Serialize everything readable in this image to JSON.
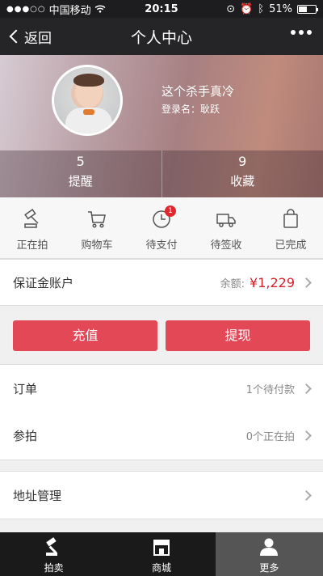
{
  "status": {
    "carrier": "中国移动",
    "time": "20:15",
    "battery": "51%"
  },
  "nav": {
    "back": "返回",
    "title": "个人中心"
  },
  "profile": {
    "name": "这个杀手真冷",
    "login_label": "登录名：耿跃"
  },
  "stats": [
    {
      "num": "5",
      "label": "提醒"
    },
    {
      "num": "9",
      "label": "收藏"
    }
  ],
  "icons": [
    {
      "label": "正在拍",
      "icon": "auction-hammer-icon"
    },
    {
      "label": "购物车",
      "icon": "cart-icon"
    },
    {
      "label": "待支付",
      "icon": "clock-icon",
      "badge": "1"
    },
    {
      "label": "待签收",
      "icon": "truck-icon"
    },
    {
      "label": "已完成",
      "icon": "bag-icon"
    }
  ],
  "deposit": {
    "label": "保证金账户",
    "balance_label": "余额:",
    "amount": "¥1,229"
  },
  "buttons": {
    "recharge": "充值",
    "withdraw": "提现"
  },
  "orders": {
    "label": "订单",
    "sub": "1个待付款"
  },
  "bids": {
    "label": "参拍",
    "sub": "0个正在拍"
  },
  "address": {
    "label": "地址管理"
  },
  "tabs": [
    {
      "label": "拍卖",
      "icon": "gavel-icon"
    },
    {
      "label": "商城",
      "icon": "store-icon"
    },
    {
      "label": "更多",
      "icon": "user-icon"
    }
  ],
  "colors": {
    "accent": "#e34856",
    "price": "#d4212c",
    "badge": "#e0262e"
  }
}
